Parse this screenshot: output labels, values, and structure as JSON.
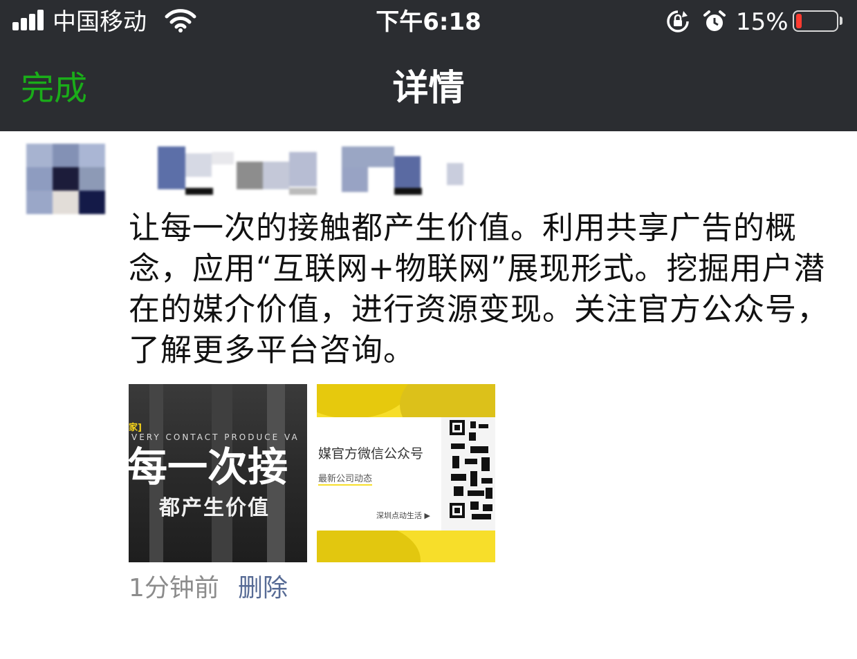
{
  "status_bar": {
    "carrier": "中国移动",
    "time": "下午6:18",
    "battery_percent": "15%",
    "battery_level": 0.15,
    "icons": [
      "signal-icon",
      "wifi-icon",
      "rotation-lock-icon",
      "alarm-icon",
      "battery-icon"
    ]
  },
  "nav": {
    "done_label": "完成",
    "title": "详情"
  },
  "post": {
    "text": "让每一次的接触都产生价值。利用共享广告的概念，应用“互联网+物联网”展现形式。挖掘用户潜在的媒介价值，进行资源变现。关注官方公众号，了解更多平台咨询。",
    "time": "1分钟前",
    "delete_label": "删除",
    "images": [
      {
        "tag": "家]",
        "english": "VERY CONTACT PRODUCE VA",
        "headline": "每一次接",
        "subline": "都产生价值"
      },
      {
        "title": "媒官方微信公众号",
        "subtitle": "最新公司动态",
        "link": "深圳点动生活 ▶"
      }
    ]
  },
  "colors": {
    "bar_bg": "#2b2d31",
    "done_green": "#1aad19",
    "link_blue": "#576b95",
    "meta_gray": "#8c8c8c",
    "battery_red": "#ff3b30",
    "promo_yellow": "#f7de2a"
  }
}
